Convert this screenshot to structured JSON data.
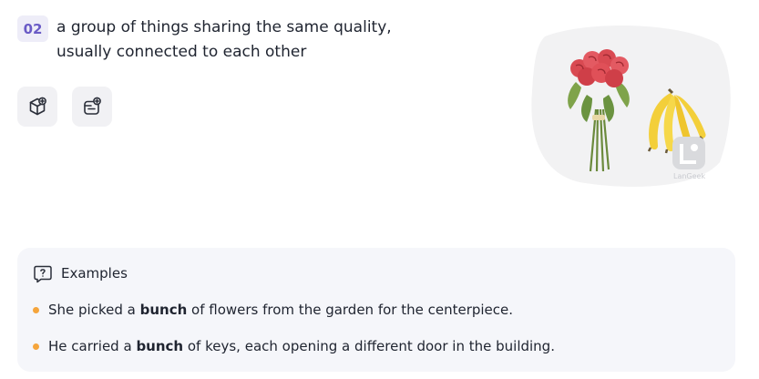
{
  "sense": {
    "number": "02",
    "definition_lines": [
      "a group of things sharing the same quality,",
      "usually connected to each other"
    ]
  },
  "actions": [
    {
      "icon": "cube-add-icon"
    },
    {
      "icon": "card-add-icon"
    }
  ],
  "illustration": {
    "subject": "bunch of roses and bunch of bananas",
    "watermark": "LanGeek"
  },
  "examples": {
    "title": "Examples",
    "items": [
      {
        "before": "She picked a ",
        "keyword": "bunch",
        "after": " of flowers from the garden for the centerpiece."
      },
      {
        "before": "He carried a ",
        "keyword": "bunch",
        "after": " of keys, each opening a different door in the building."
      }
    ]
  },
  "colors": {
    "accent": "#6a5bc6",
    "bullet": "#f5a53c",
    "panel_bg": "#f5f6fa"
  }
}
